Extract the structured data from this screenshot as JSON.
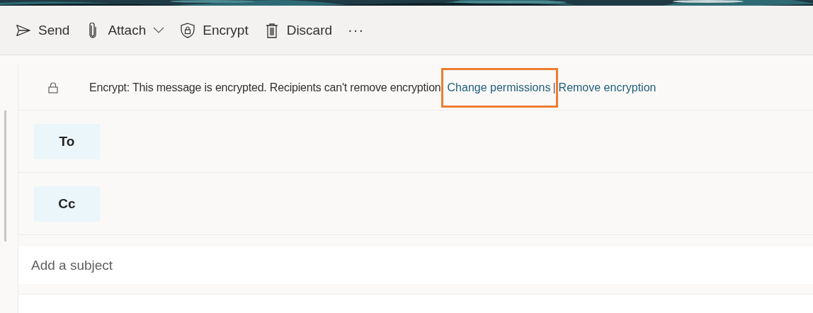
{
  "toolbar": {
    "items": [
      {
        "kind": "send",
        "label": "Send"
      },
      {
        "kind": "attach",
        "label": "Attach",
        "dropdown": true
      },
      {
        "kind": "encrypt",
        "label": "Encrypt"
      },
      {
        "kind": "discard",
        "label": "Discard"
      },
      {
        "kind": "more",
        "label": "···"
      }
    ]
  },
  "encryption_bar": {
    "message": "Encrypt: This message is encrypted. Recipients can't remove encryption",
    "links": [
      {
        "label": "Change permissions",
        "highlighted": true
      },
      {
        "label": "Remove encryption",
        "highlighted": false
      }
    ],
    "separator": "|"
  },
  "recipients": [
    {
      "label": "To"
    },
    {
      "label": "Cc"
    }
  ],
  "subject": {
    "placeholder": "Add a subject"
  }
}
